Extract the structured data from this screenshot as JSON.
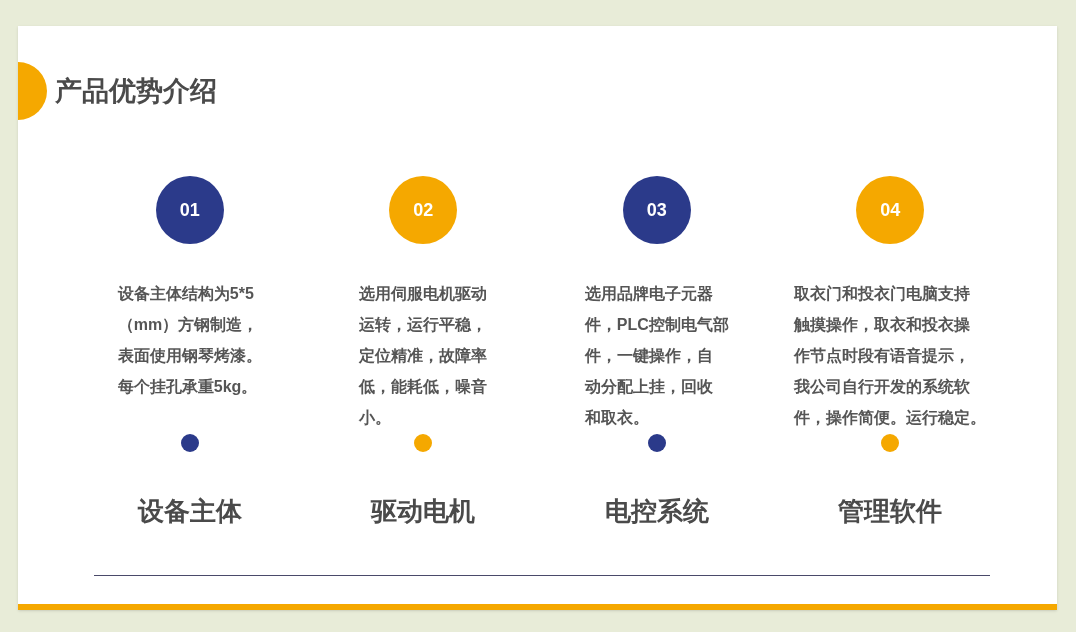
{
  "title": "产品优势介绍",
  "items": [
    {
      "number": "01",
      "color": "#2b3a8a",
      "lines": [
        "设备主体结构为5*5",
        "（mm）方钢制造，",
        "表面使用钢琴烤漆。",
        "每个挂孔承重5kg。"
      ],
      "label": "设备主体"
    },
    {
      "number": "02",
      "color": "#f5a800",
      "lines": [
        "选用伺服电机驱动",
        "运转，运行平稳，",
        "定位精准，故障率",
        "低，能耗低，噪音",
        "小。"
      ],
      "label": "驱动电机"
    },
    {
      "number": "03",
      "color": "#2b3a8a",
      "lines": [
        "选用品牌电子元器",
        "件，PLC控制电气部",
        "件，一键操作，自",
        "动分配上挂，回收",
        "和取衣。"
      ],
      "label": "电控系统"
    },
    {
      "number": "04",
      "color": "#f5a800",
      "lines": [
        "取衣门和投衣门电脑支持",
        "触摸操作，取衣和投衣操",
        "作节点时段有语音提示，",
        "我公司自行开发的系统软",
        "件，操作简便。运行稳定。"
      ],
      "label": "管理软件"
    }
  ]
}
